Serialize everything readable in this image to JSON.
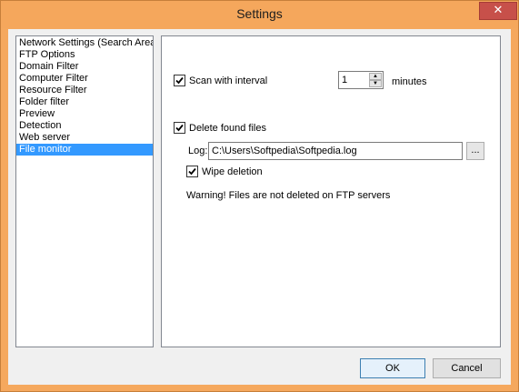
{
  "window": {
    "title": "Settings",
    "close_glyph": "✕"
  },
  "sidebar": {
    "items": [
      {
        "label": "Network Settings (Search Area"
      },
      {
        "label": "FTP Options"
      },
      {
        "label": "Domain Filter"
      },
      {
        "label": "Computer Filter"
      },
      {
        "label": "Resource Filter"
      },
      {
        "label": "Folder filter"
      },
      {
        "label": "Preview"
      },
      {
        "label": "Detection"
      },
      {
        "label": "Web server"
      },
      {
        "label": "File monitor"
      }
    ],
    "selected_index": 9
  },
  "panel": {
    "scan": {
      "label": "Scan with interval",
      "checked": true
    },
    "interval": {
      "value": "1",
      "unit": "minutes"
    },
    "delete": {
      "label": "Delete found files",
      "checked": true
    },
    "log": {
      "label": "Log:",
      "value": "C:\\Users\\Softpedia\\Softpedia.log",
      "browse_label": "..."
    },
    "wipe": {
      "label": "Wipe deletion",
      "checked": true
    },
    "warning": "Warning! Files are not deleted on FTP servers"
  },
  "footer": {
    "ok_label": "OK",
    "cancel_label": "Cancel"
  },
  "colors": {
    "titlebar": "#f5a75c",
    "selection": "#3399ff",
    "close": "#c7504a"
  }
}
